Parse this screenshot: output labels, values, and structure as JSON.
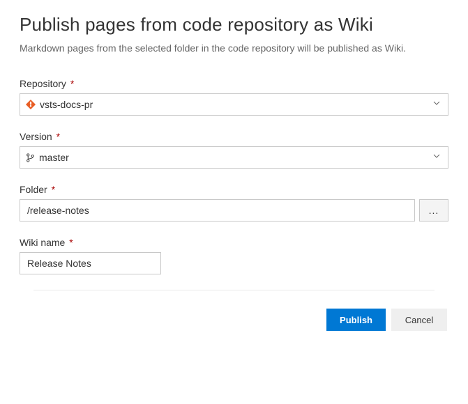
{
  "header": {
    "title": "Publish pages from code repository as Wiki",
    "subtitle": "Markdown pages from the selected folder in the code repository will be published as Wiki."
  },
  "fields": {
    "repository": {
      "label": "Repository",
      "required_marker": "*",
      "value": "vsts-docs-pr"
    },
    "version": {
      "label": "Version",
      "required_marker": "*",
      "value": "master"
    },
    "folder": {
      "label": "Folder",
      "required_marker": "*",
      "value": "/release-notes",
      "browse_label": "..."
    },
    "wiki_name": {
      "label": "Wiki name",
      "required_marker": "*",
      "value": "Release Notes"
    }
  },
  "actions": {
    "publish": "Publish",
    "cancel": "Cancel"
  }
}
